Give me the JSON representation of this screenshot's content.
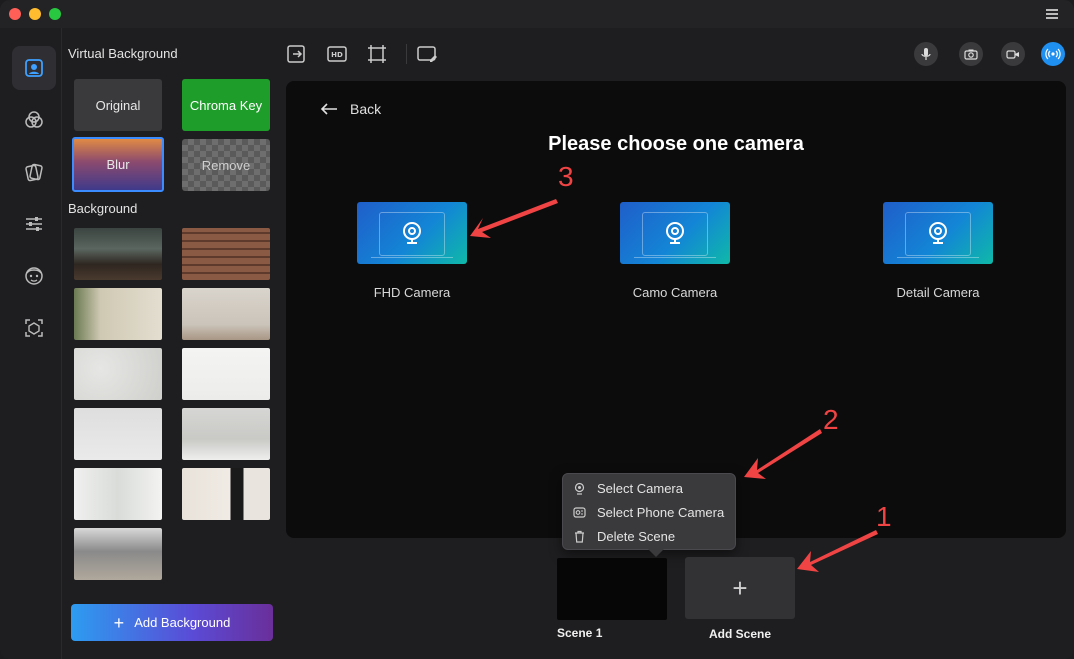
{
  "panel": {
    "virtual_background_title": "Virtual Background",
    "tiles": {
      "original": "Original",
      "chroma_key": "Chroma Key",
      "blur": "Blur",
      "remove": "Remove"
    },
    "background_title": "Background",
    "add_background": "Add Background"
  },
  "main": {
    "back_label": "Back",
    "title": "Please choose one camera",
    "cameras": [
      {
        "label": "FHD Camera"
      },
      {
        "label": "Camo Camera"
      },
      {
        "label": "Detail Camera"
      }
    ]
  },
  "context_menu": {
    "items": [
      {
        "label": "Select Camera",
        "icon": "camera-pin-icon"
      },
      {
        "label": "Select Phone Camera",
        "icon": "phone-camera-icon"
      },
      {
        "label": "Delete Scene",
        "icon": "trash-icon"
      }
    ]
  },
  "scenes": {
    "scene1_label": "Scene 1",
    "add_scene_label": "Add Scene",
    "add_scene_symbol": "+"
  },
  "annotations": {
    "n1": "1",
    "n2": "2",
    "n3": "3"
  },
  "colors": {
    "accent": "#1f8ff0",
    "chroma": "#1f9d2b",
    "annotation": "#f04444"
  }
}
